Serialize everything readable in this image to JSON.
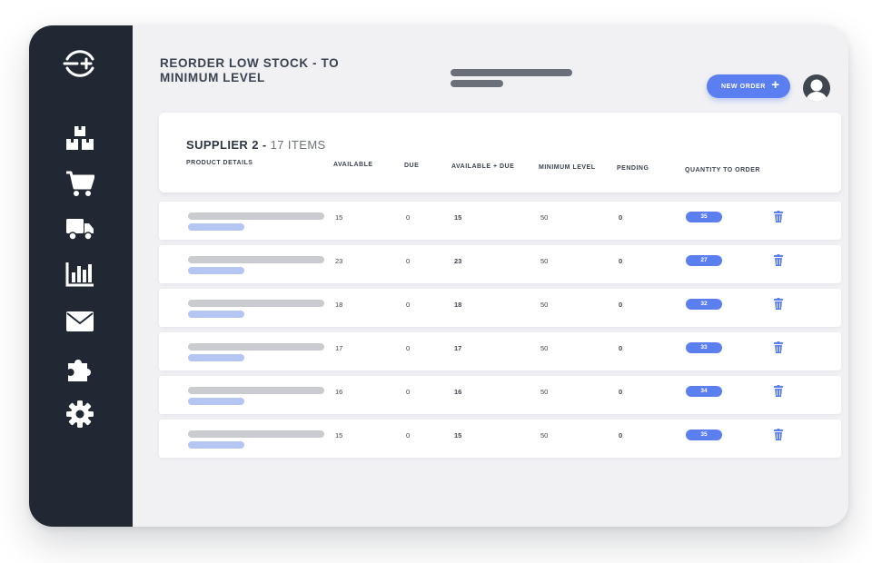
{
  "header": {
    "title": "REORDER LOW STOCK - TO MINIMUM LEVEL",
    "new_order_label": "NEW ORDER",
    "new_order_icon": "plus-icon"
  },
  "sidebar": {
    "logo_icon": "exchange-plus-logo",
    "items": [
      {
        "icon": "boxes-icon"
      },
      {
        "icon": "cart-icon"
      },
      {
        "icon": "truck-icon"
      },
      {
        "icon": "bar-chart-icon"
      },
      {
        "icon": "mail-icon"
      },
      {
        "icon": "puzzle-icon"
      },
      {
        "icon": "gear-icon"
      }
    ]
  },
  "supplier": {
    "name": "SUPPLIER 2 -",
    "count": "17 ITEMS"
  },
  "columns": {
    "product": "PRODUCT DETAILS",
    "available": "AVAILABLE",
    "due": "DUE",
    "available_due": "AVAILABLE + DUE",
    "minimum": "MINIMUM LEVEL",
    "pending": "PENDING",
    "quantity": "QUANTITY TO ORDER"
  },
  "rows": [
    {
      "available": "15",
      "due": "0",
      "available_due": "15",
      "minimum": "50",
      "pending": "0",
      "quantity": "35"
    },
    {
      "available": "23",
      "due": "0",
      "available_due": "23",
      "minimum": "50",
      "pending": "0",
      "quantity": "27"
    },
    {
      "available": "18",
      "due": "0",
      "available_due": "18",
      "minimum": "50",
      "pending": "0",
      "quantity": "32"
    },
    {
      "available": "17",
      "due": "0",
      "available_due": "17",
      "minimum": "50",
      "pending": "0",
      "quantity": "33"
    },
    {
      "available": "16",
      "due": "0",
      "available_due": "16",
      "minimum": "50",
      "pending": "0",
      "quantity": "34"
    },
    {
      "available": "15",
      "due": "0",
      "available_due": "15",
      "minimum": "50",
      "pending": "0",
      "quantity": "35"
    }
  ],
  "colors": {
    "sidebar": "#212833",
    "accent": "#5b7ff0",
    "background": "#f1f1f4"
  }
}
